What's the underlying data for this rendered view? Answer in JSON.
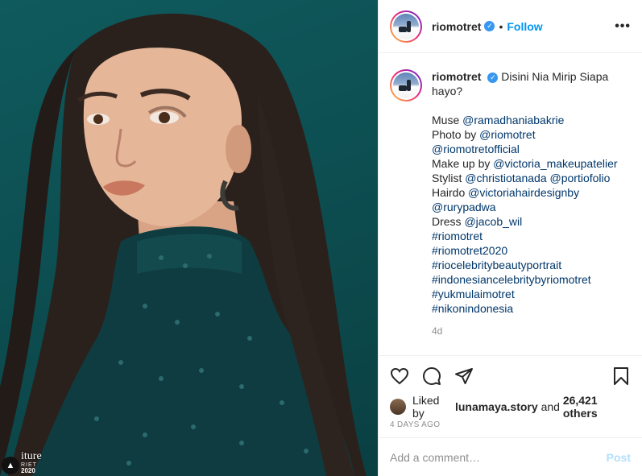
{
  "post": {
    "username": "riomotret",
    "follow_label": "Follow",
    "dot": "•",
    "more_icon": "•••"
  },
  "caption": {
    "username": "riomotret",
    "lines": [
      {
        "text": "Disini Nia Mirip Siapa"
      },
      {
        "text": "hayo?"
      },
      {
        "text": ""
      },
      {
        "prefix": "Muse ",
        "mention": "@ramadhaniabakrie"
      },
      {
        "prefix": "Photo by ",
        "mention": "@riomotret"
      },
      {
        "prefix": "",
        "mention": "@riomotretofficial"
      },
      {
        "prefix": "Make up by ",
        "mention": "@victoria_makeupatelier"
      },
      {
        "prefix": "Stylist ",
        "mention": "@christiotanada @portiofolio"
      },
      {
        "prefix": "Hairdo ",
        "mention": "@victoriahairdesignby"
      },
      {
        "prefix": "",
        "mention": "@rurypadwa"
      },
      {
        "prefix": "Dress ",
        "mention": "@jacob_wil"
      },
      {
        "prefix": "",
        "mention": "#riomotret"
      },
      {
        "prefix": "",
        "mention": "#riomotret2020"
      },
      {
        "prefix": "",
        "mention": "#riocelebritybeautyportrait"
      },
      {
        "prefix": "",
        "mention": "#indonesiancelebritybyriomotret"
      },
      {
        "prefix": "",
        "mention": "#yukmulaimotret"
      },
      {
        "prefix": "",
        "mention": "#nikonindonesia"
      }
    ],
    "age": "4d"
  },
  "likes": {
    "prefix": "Liked by ",
    "user": "lunamaya.story",
    "middle": " and ",
    "count": "26,421 others"
  },
  "timestamp": "4 DAYS AGO",
  "comment_box": {
    "placeholder": "Add a comment…",
    "post_label": "Post"
  },
  "watermark": {
    "big": "iture",
    "small": "RIET",
    "year": "2020"
  },
  "colors": {
    "background_teal": "#0d4f52",
    "link_blue": "#0095f6",
    "mention_blue": "#00376b",
    "verified_blue": "#3897f0",
    "muted_gray": "#8e8e8e"
  },
  "icons": [
    "heart-icon",
    "comment-icon",
    "share-icon",
    "bookmark-icon",
    "verified-icon",
    "more-options-icon"
  ]
}
